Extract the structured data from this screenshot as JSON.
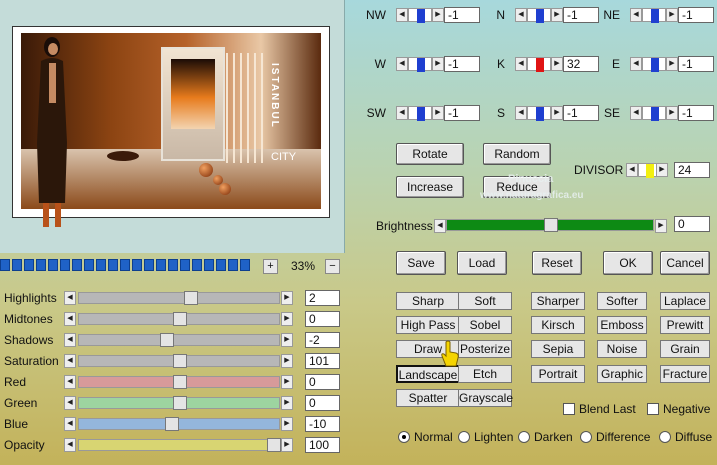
{
  "zoom": {
    "plus": "+",
    "value": "33%",
    "minus": "−"
  },
  "preview": {
    "word": "ISTANBUL",
    "city": "CITY"
  },
  "adjustments": [
    {
      "label": "Highlights",
      "value": "2",
      "level": 0.56,
      "color": "#b7b7b7"
    },
    {
      "label": "Midtones",
      "value": "0",
      "level": 0.5,
      "color": "#b7b7b7"
    },
    {
      "label": "Shadows",
      "value": "-2",
      "level": 0.43,
      "color": "#b7b7b7"
    },
    {
      "label": "Saturation",
      "value": "101",
      "level": 0.5,
      "color": "#b7b7b7"
    },
    {
      "label": "Red",
      "value": "0",
      "level": 0.5,
      "color": "#d79a9a"
    },
    {
      "label": "Green",
      "value": "0",
      "level": 0.5,
      "color": "#9dd4a0"
    },
    {
      "label": "Blue",
      "value": "-10",
      "level": 0.46,
      "color": "#94b6dc"
    },
    {
      "label": "Opacity",
      "value": "100",
      "level": 1.0,
      "color": "#d8d572"
    }
  ],
  "kernel": [
    {
      "label": "NW",
      "value": "-1",
      "color": "#1f3fd0"
    },
    {
      "label": "N",
      "value": "-1",
      "color": "#1f3fd0"
    },
    {
      "label": "NE",
      "value": "-1",
      "color": "#1f3fd0"
    },
    {
      "label": "W",
      "value": "-1",
      "color": "#1f3fd0"
    },
    {
      "label": "K",
      "value": "32",
      "color": "#e01414"
    },
    {
      "label": "E",
      "value": "-1",
      "color": "#1f3fd0"
    },
    {
      "label": "SW",
      "value": "-1",
      "color": "#1f3fd0"
    },
    {
      "label": "S",
      "value": "-1",
      "color": "#1f3fd0"
    },
    {
      "label": "SE",
      "value": "-1",
      "color": "#1f3fd0"
    }
  ],
  "kernel_buttons": {
    "rotate": "Rotate",
    "random": "Random",
    "increase": "Increase",
    "reduce": "Reduce"
  },
  "divisor": {
    "label": "DIVISOR",
    "value": "24",
    "color": "#f2ef10"
  },
  "brightness": {
    "label": "Brightness",
    "value": "0",
    "level": 0.5,
    "color": "#0d8a14"
  },
  "actions": {
    "save": "Save",
    "load": "Load",
    "reset": "Reset",
    "ok": "OK",
    "cancel": "Cancel"
  },
  "filters": [
    [
      "Sharp",
      "Soft",
      "Sharper",
      "Softer",
      "Laplace"
    ],
    [
      "High Pass",
      "Sobel",
      "Kirsch",
      "Emboss",
      "Prewitt"
    ],
    [
      "Draw",
      "Posterize",
      "Sepia",
      "Noise",
      "Grain"
    ],
    [
      "Landscape",
      "Etch",
      "Portrait",
      "Graphic",
      "Fracture"
    ],
    [
      "Spatter",
      "Grayscale"
    ]
  ],
  "checkboxes": {
    "blend_last": "Blend Last",
    "negative": "Negative"
  },
  "blend_modes": [
    "Normal",
    "Lighten",
    "Darken",
    "Difference",
    "Diffuse"
  ],
  "watermark": {
    "line1": "Pinuccia",
    "line2": "www.naturagrafica.eu"
  }
}
